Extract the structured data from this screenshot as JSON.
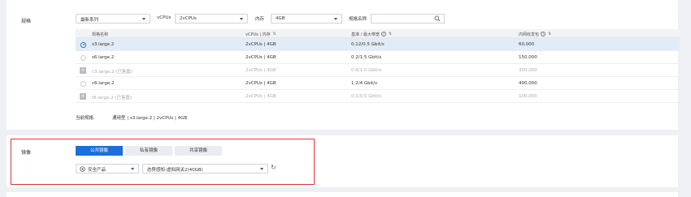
{
  "spec_section": {
    "label": "规格",
    "filters": {
      "series_value": "最新系列",
      "vcpus_label": "vCPUs",
      "vcpus_value": "2vCPUs",
      "memory_label": "内存",
      "memory_value": "4GB",
      "spec_name_label": "规格名称",
      "spec_name_value": ""
    },
    "table": {
      "headers": [
        "规格名称",
        "vCPUs | 内存",
        "基准 / 最大带宽",
        "内网收发包"
      ],
      "rows": [
        {
          "name": "s3.large.2",
          "vcpu_mem": "2vCPUs | 4GB",
          "bandwidth": "0.12/0.5 Gbit/s",
          "pps": "60,000",
          "selected": true,
          "soldout": false
        },
        {
          "name": "s6.large.2",
          "vcpu_mem": "2vCPUs | 4GB",
          "bandwidth": "0.2/1.5 Gbit/s",
          "pps": "150,000",
          "selected": false,
          "soldout": false
        },
        {
          "name": "c3.large.2 (已售罄)",
          "vcpu_mem": "2vCPUs | 4GB",
          "bandwidth": "0.6/1.5 Gbit/s",
          "pps": "300,000",
          "selected": false,
          "soldout": true
        },
        {
          "name": "c6.large.2",
          "vcpu_mem": "2vCPUs | 4GB",
          "bandwidth": "1.2/4 Gbit/s",
          "pps": "400,000",
          "selected": false,
          "soldout": false
        },
        {
          "name": "t6.large.2 (已售罄)",
          "vcpu_mem": "2vCPUs | 4GB",
          "bandwidth": "0.1/0.5 Gbit/s",
          "pps": "100,000",
          "selected": false,
          "soldout": true
        }
      ]
    },
    "current_label": "当前规格",
    "current_value": "通用型 | s3.large.2 | 2vCPUs | 4GB"
  },
  "image_section": {
    "label": "镜像",
    "tabs": [
      "公共镜像",
      "私有镜像",
      "共享镜像"
    ],
    "active_tab": 0,
    "os_value": "安全产品",
    "image_value": "态势感知-虚拟网关2(40GB)"
  },
  "icons": {
    "search": "search-icon",
    "info": "info-icon",
    "sort": "sort-icon",
    "refresh": "refresh-icon",
    "soldout": "soldout-icon",
    "os": "os-logo-icon"
  },
  "colors": {
    "accent": "#1a6fd8",
    "highlight_row": "#e1ecf7",
    "annotation_box": "#e03535"
  }
}
